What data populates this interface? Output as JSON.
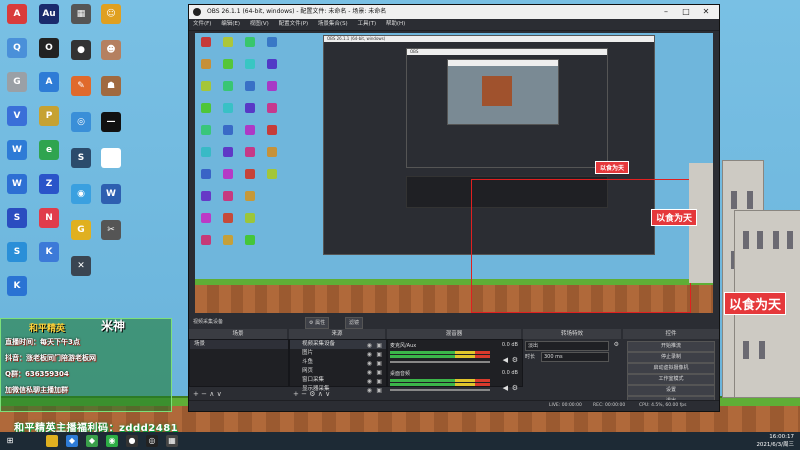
{
  "desktop": {
    "icons_col1": [
      {
        "label": "",
        "glyph": "A",
        "color": "#d93b3b"
      },
      {
        "label": "",
        "glyph": "Q",
        "color": "#4a90d9"
      },
      {
        "label": "",
        "glyph": "G",
        "color": "#9aa0a6"
      },
      {
        "label": "",
        "glyph": "V",
        "color": "#3a6fd8"
      },
      {
        "label": "",
        "glyph": "W",
        "color": "#2e7bd6"
      },
      {
        "label": "",
        "glyph": "W",
        "color": "#2d6fd3"
      },
      {
        "label": "",
        "glyph": "S",
        "color": "#2a4dc0"
      },
      {
        "label": "",
        "glyph": "S",
        "color": "#2a8fd8"
      },
      {
        "label": "",
        "glyph": "K",
        "color": "#2a73d3"
      }
    ],
    "icons_col2": [
      {
        "label": "",
        "glyph": "Au",
        "color": "#1a2a6c"
      },
      {
        "label": "",
        "glyph": "O",
        "color": "#222"
      },
      {
        "label": "",
        "glyph": "A",
        "color": "#2e7cd6"
      },
      {
        "label": "",
        "glyph": "P",
        "color": "#c6a233"
      },
      {
        "label": "",
        "glyph": "e",
        "color": "#2fa44f"
      },
      {
        "label": "",
        "glyph": "Z",
        "color": "#2a54c9"
      },
      {
        "label": "",
        "glyph": "N",
        "color": "#e03c4b"
      },
      {
        "label": "",
        "glyph": "K",
        "color": "#3c7ad8"
      }
    ],
    "icons_col3": [
      {
        "label": "",
        "glyph": "▦",
        "color": "#555"
      },
      {
        "label": "",
        "glyph": "●",
        "color": "#333"
      },
      {
        "label": "",
        "glyph": "✎",
        "color": "#e06a2c"
      },
      {
        "label": "",
        "glyph": "◎",
        "color": "#3a8fd8"
      },
      {
        "label": "",
        "glyph": "S",
        "color": "#2b4b6c"
      },
      {
        "label": "",
        "glyph": "◉",
        "color": "#3aa0e0"
      },
      {
        "label": "",
        "glyph": "G",
        "color": "#e0b020"
      },
      {
        "label": "",
        "glyph": "✕",
        "color": "#3a4552"
      }
    ],
    "icons_col4": [
      {
        "label": "",
        "glyph": "☺",
        "color": "#e0a020"
      },
      {
        "label": "",
        "glyph": "☻",
        "color": "#b58060"
      },
      {
        "label": "",
        "glyph": "☗",
        "color": "#a06a40"
      },
      {
        "label": "",
        "glyph": "—",
        "color": "#111"
      },
      {
        "label": "",
        "glyph": "▭",
        "color": "#fff"
      },
      {
        "label": "",
        "glyph": "W",
        "color": "#2e5fb0"
      },
      {
        "label": "",
        "glyph": "✂",
        "color": "#555"
      }
    ]
  },
  "overlay": {
    "title_left": "和平精英",
    "title_right": "米神",
    "line1": "直播时间：每天下午3点",
    "line2": "抖音：涨老板同门陪游老板网",
    "line3": "Q群：636359304",
    "line4": "加微信私聊主播加群",
    "bottom": "和平精英主播福利码：zddd2481"
  },
  "banners": {
    "top": "以食为天",
    "mid": "以食为天",
    "big": "以食为天"
  },
  "obs": {
    "title": "OBS 26.1.1 (64-bit, windows) - 配置文件: 未命名 - 场景: 未命名",
    "menu": [
      "文件(F)",
      "编辑(E)",
      "视图(V)",
      "配置文件(P)",
      "场景集合(S)",
      "工具(T)",
      "帮助(H)"
    ],
    "dock_titles": {
      "scenes": "场景",
      "sources": "来源",
      "mixer": "混音器",
      "transitions": "转场特效",
      "controls": "控件"
    },
    "source_bar": {
      "label": "视频采集设备",
      "props": "⚙ 属性",
      "filters": "滤镜"
    },
    "scenes": [
      "场景"
    ],
    "sources": [
      "视频采集设备",
      "图片",
      "斗鱼",
      "网页",
      "窗口采集",
      "显示器采集"
    ],
    "mixer": {
      "ch1": {
        "name": "麦克风/Aux",
        "db": "0.0 dB"
      },
      "ch2": {
        "name": "桌面音频",
        "db": "0.0 dB"
      }
    },
    "transitions": {
      "type": "淡出",
      "duration_label": "时长",
      "duration": "300 ms"
    },
    "controls": [
      "开始推流",
      "停止录制",
      "启动虚拟摄像机",
      "工作室模式",
      "设置",
      "退出"
    ],
    "status": {
      "live": "LIVE: 00:00:00",
      "rec": "REC: 00:00:00",
      "cpu": "CPU: 4.5%, 60.00 fps"
    }
  },
  "taskbar": {
    "time": "16:00:17",
    "date": "2021/6/3/周三"
  },
  "colors": {
    "obs_bg": "#2b2d33",
    "accent_red": "#e02020",
    "sky": "#6fb6dc",
    "grass": "#5fae36"
  }
}
